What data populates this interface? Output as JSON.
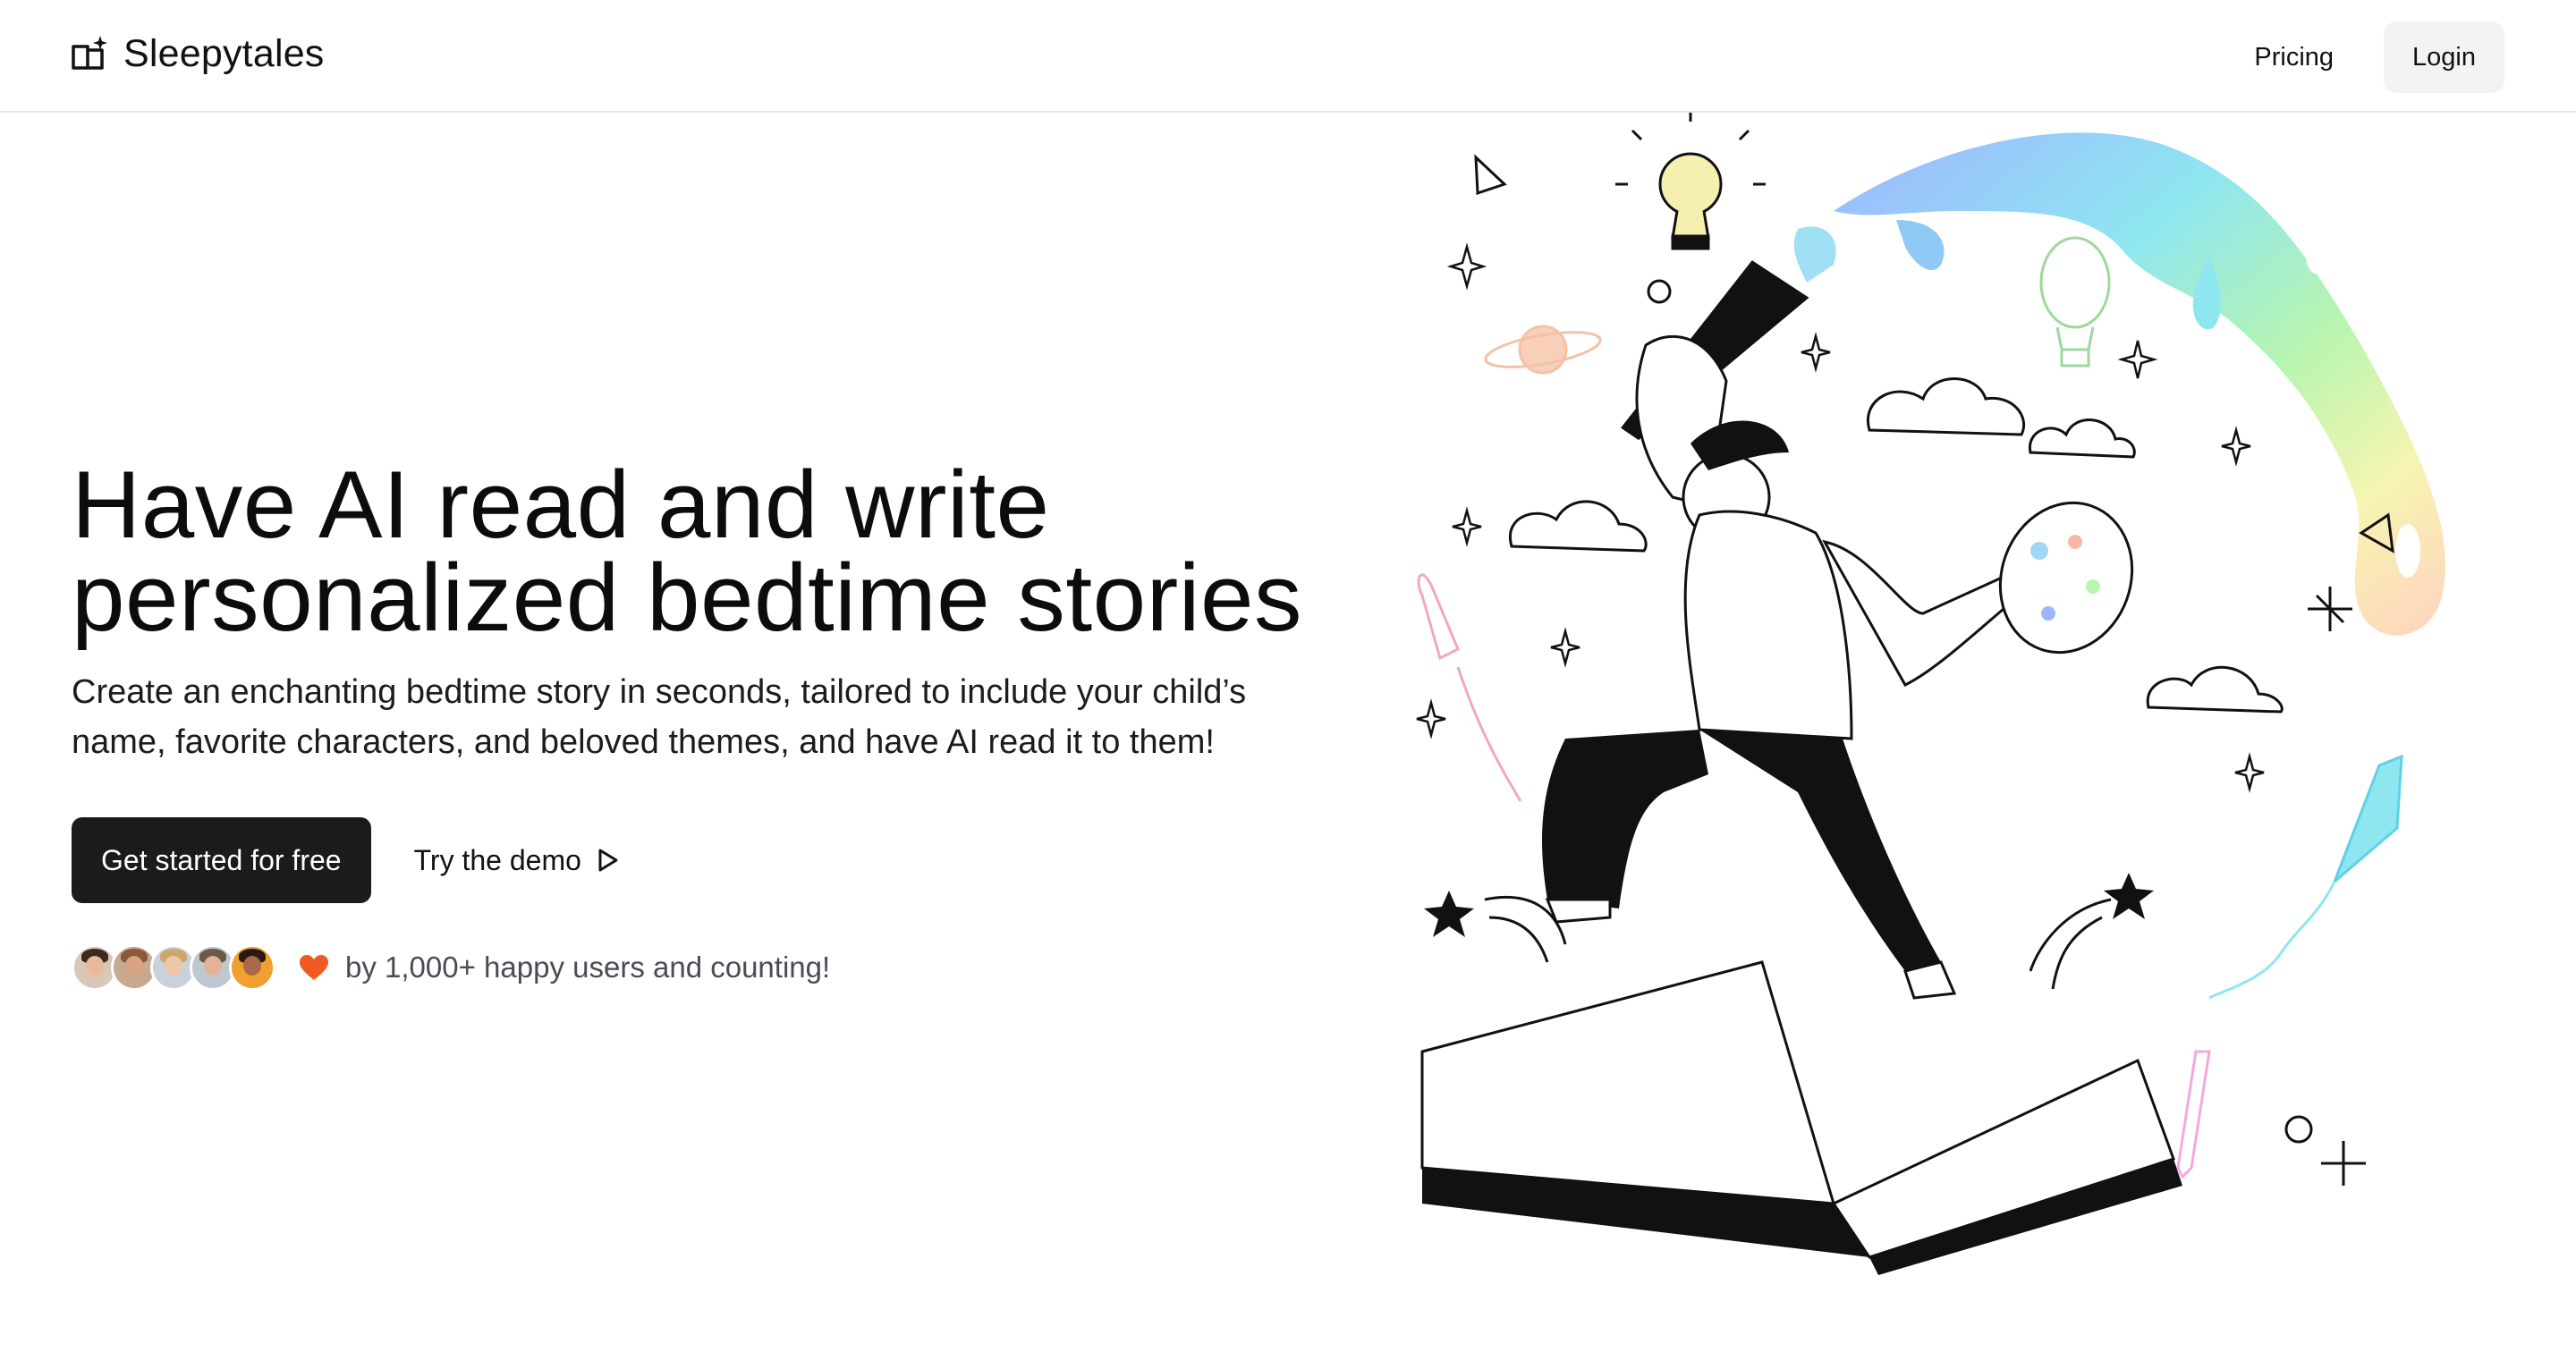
{
  "nav": {
    "brand": "Sleepytales",
    "brand_icon": "open-book-sparkle-icon",
    "pricing": "Pricing",
    "login": "Login"
  },
  "hero": {
    "headline_line1": "Have AI read and write",
    "headline_line2": "personalized bedtime stories",
    "subtext": "Create an enchanting bedtime story in seconds, tailored to include your child’s name, favorite characters, and beloved themes, and have AI read it to them!",
    "primary_cta": "Get started for free",
    "secondary_cta": "Try the demo",
    "secondary_icon": "play-outline-icon"
  },
  "social_proof": {
    "avatar_count": 5,
    "heart_icon": "heart-icon",
    "text": "by 1,000+ happy users and counting!"
  },
  "colors": {
    "primary_button": "#1b1b1b",
    "login_bg": "#f3f3f3",
    "heart": "#f05a22",
    "subtle_text": "#4b4b55"
  }
}
